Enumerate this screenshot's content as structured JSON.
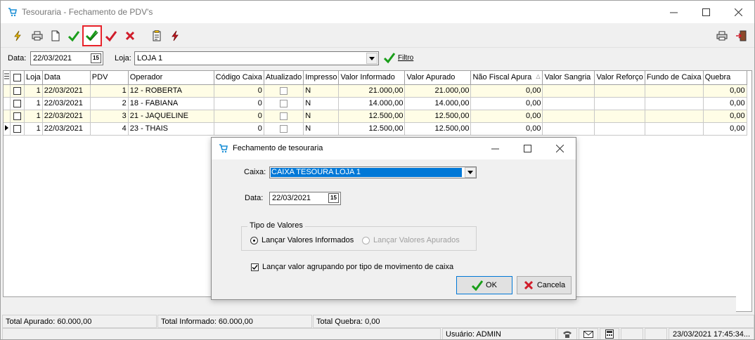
{
  "window": {
    "title": "Tesouraria - Fechamento de PDV's"
  },
  "filter": {
    "data_label": "Data:",
    "data_value": "22/03/2021",
    "loja_label": "Loja:",
    "loja_value": "LOJA 1",
    "filtro_label": "Filtro"
  },
  "grid": {
    "columns": [
      "Loja",
      "Data",
      "PDV",
      "Operador",
      "Código Caixa",
      "Atualizado",
      "Impresso",
      "Valor Informado",
      "Valor Apurado",
      "Não Fiscal Apura",
      "Valor Sangria",
      "Valor Reforço",
      "Fundo de Caixa",
      "Quebra"
    ],
    "rows": [
      {
        "loja": "1",
        "data": "22/03/2021",
        "pdv": "1",
        "operador": "12 - ROBERTA",
        "codigo": "0",
        "impresso": "N",
        "informado": "21.000,00",
        "apurado": "21.000,00",
        "naofiscal": "0,00",
        "quebra": "0,00"
      },
      {
        "loja": "1",
        "data": "22/03/2021",
        "pdv": "2",
        "operador": "18 - FABIANA",
        "codigo": "0",
        "impresso": "N",
        "informado": "14.000,00",
        "apurado": "14.000,00",
        "naofiscal": "0,00",
        "quebra": "0,00"
      },
      {
        "loja": "1",
        "data": "22/03/2021",
        "pdv": "3",
        "operador": "21 - JAQUELINE",
        "codigo": "0",
        "impresso": "N",
        "informado": "12.500,00",
        "apurado": "12.500,00",
        "naofiscal": "0,00",
        "quebra": "0,00"
      },
      {
        "loja": "1",
        "data": "22/03/2021",
        "pdv": "4",
        "operador": "23 - THAIS",
        "codigo": "0",
        "impresso": "N",
        "informado": "12.500,00",
        "apurado": "12.500,00",
        "naofiscal": "0,00",
        "quebra": "0,00"
      }
    ]
  },
  "totals": {
    "apurado": "Total Apurado: 60.000,00",
    "informado": "Total Informado: 60.000,00",
    "quebra": "Total Quebra: 0,00"
  },
  "status": {
    "usuario": "Usuário: ADMIN",
    "datetime": "23/03/2021 17:45:34..."
  },
  "dialog": {
    "title": "Fechamento de tesouraria",
    "caixa_label": "Caixa:",
    "caixa_value": "CAIXA TESOURA LOJA 1",
    "data_label": "Data:",
    "data_value": "22/03/2021",
    "tipo_title": "Tipo de Valores",
    "radio_informados": "Lançar Valores Informados",
    "radio_apurados": "Lançar Valores Apurados",
    "check_agrupar": "Lançar valor agrupando por tipo de movimento de caixa",
    "ok_label": "OK",
    "cancel_label": "Cancela"
  },
  "colors": {
    "accent": "#0078d7",
    "check_green": "#1a9e1a",
    "check_red": "#d01c2a",
    "row_alt": "#fffde6"
  }
}
